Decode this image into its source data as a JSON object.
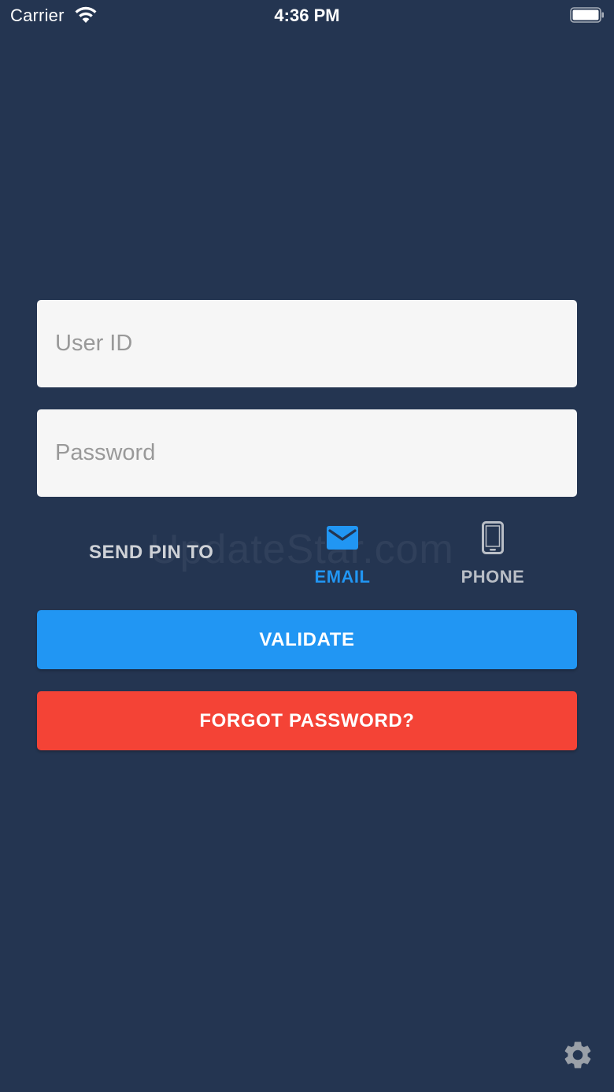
{
  "status_bar": {
    "carrier": "Carrier",
    "time": "4:36 PM",
    "wifi_icon": "wifi-icon",
    "battery_icon": "battery-icon"
  },
  "form": {
    "user_id_placeholder": "User ID",
    "user_id_value": "",
    "password_placeholder": "Password",
    "password_value": ""
  },
  "send_pin": {
    "label": "SEND PIN TO",
    "selected": "email",
    "options": [
      {
        "id": "email",
        "label": "EMAIL",
        "icon": "envelope-icon",
        "color": "#2196f3"
      },
      {
        "id": "phone",
        "label": "PHONE",
        "icon": "phone-icon",
        "color": "#b9bec6"
      }
    ]
  },
  "watermark": "UpdateStar.com",
  "actions": {
    "validate_label": "VALIDATE",
    "validate_color": "#2196f3",
    "forgot_label": "FORGOT PASSWORD?",
    "forgot_color": "#f44336"
  },
  "footer": {
    "settings_icon": "gear-icon"
  },
  "colors": {
    "background": "#243551",
    "field_background": "#f6f6f6"
  }
}
